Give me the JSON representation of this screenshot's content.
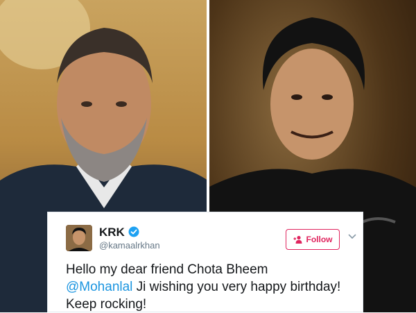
{
  "tweet": {
    "display_name": "KRK",
    "handle": "@kamaalrkhan",
    "follow_label": "Follow",
    "text_line1": "Hello my dear friend Chota Bheem",
    "mention": "@Mohanlal",
    "text_rest": " Ji wishing you very happy birthday! Keep rocking!"
  },
  "colors": {
    "follow_accent": "#e0245e",
    "mention_blue": "#1b95e0",
    "verified_blue": "#1da1f2"
  },
  "icons": {
    "verified": "verified-badge-icon",
    "follow": "add-user-icon",
    "menu": "chevron-down-icon"
  }
}
